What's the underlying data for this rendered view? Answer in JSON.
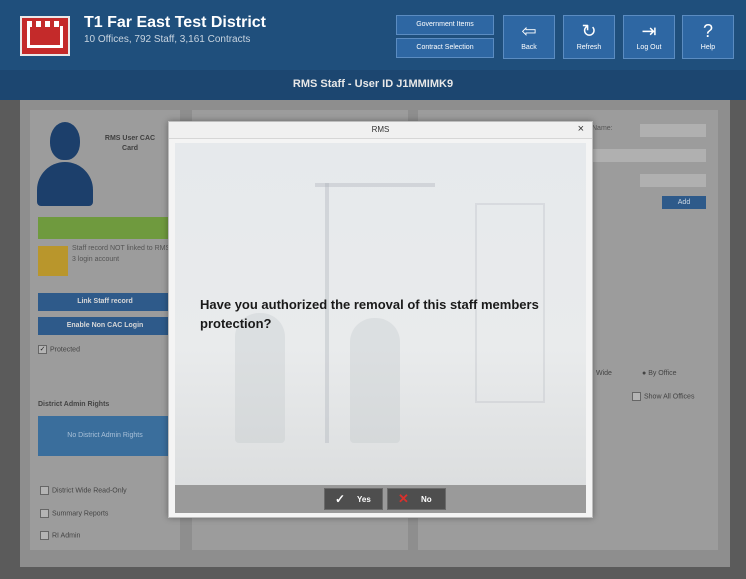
{
  "header": {
    "district_title": "T1 Far East Test District",
    "district_subtitle": "10 Offices, 792 Staff, 3,161 Contracts",
    "btn_government_items": "Government Items",
    "btn_contract_selection": "Contract Selection",
    "btn_back": "Back",
    "btn_refresh": "Refresh",
    "btn_logout": "Log Out",
    "btn_help": "Help",
    "glyph_back": "⇦",
    "glyph_refresh": "↻",
    "glyph_logout": "⇥",
    "glyph_help": "?"
  },
  "page": {
    "title": "RMS Staff - User ID J1MMIMK9"
  },
  "left_panel": {
    "cac_label": "RMS User CAC Card",
    "not_linked": "Staff record NOT linked to RMS 3 login account",
    "link_staff": "Link Staff record",
    "enable_non_cac": "Enable Non CAC Login",
    "protected_label": "Protected",
    "protected_checked": true,
    "admin_heading": "District Admin Rights",
    "admin_box": "No District Admin Rights",
    "options": [
      "District Wide Read-Only",
      "Summary Reports",
      "RI Admin"
    ]
  },
  "right_panel": {
    "name_label": "Name:",
    "add": "Add",
    "wide": "Wide",
    "by_office": "By Office",
    "show_all": "Show All Offices"
  },
  "dialog": {
    "title": "RMS",
    "close": "×",
    "message": "Have you authorized the removal of this staff members protection?",
    "yes_label": "Yes",
    "no_label": "No",
    "yes_glyph": "✓",
    "no_glyph": "✕"
  },
  "colors": {
    "header": "#1f4f7c",
    "accent_button": "#2e67a3",
    "no_icon": "#d9302c"
  }
}
